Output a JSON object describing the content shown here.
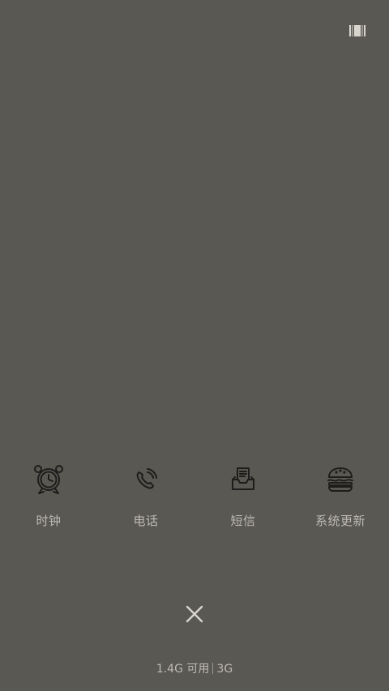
{
  "header": {
    "icon": "barcode-icon"
  },
  "apps": [
    {
      "label": "时钟",
      "icon": "alarm-clock-icon"
    },
    {
      "label": "电话",
      "icon": "phone-icon"
    },
    {
      "label": "短信",
      "icon": "message-inbox-icon"
    },
    {
      "label": "系统更新",
      "icon": "burger-icon"
    }
  ],
  "close": {
    "icon": "close-icon"
  },
  "status": {
    "memory_available": "1.4G 可用",
    "network": "3G"
  },
  "colors": {
    "background": "#5a5853",
    "label": "#bdbab3",
    "icon_stroke": "#1e1d1b"
  }
}
